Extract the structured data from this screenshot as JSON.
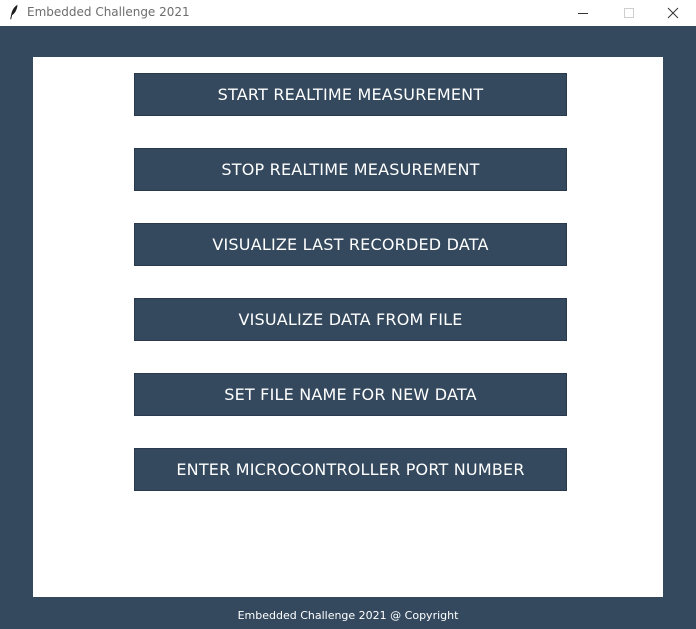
{
  "window": {
    "title": "Embedded Challenge 2021",
    "icons": {
      "app": "feather-icon",
      "minimize": "minimize-icon",
      "maximize": "maximize-icon",
      "close": "close-icon"
    }
  },
  "buttons": {
    "start_realtime": "START REALTIME MEASUREMENT",
    "stop_realtime": "STOP REALTIME MEASUREMENT",
    "visualize_last": "VISUALIZE LAST RECORDED DATA",
    "visualize_file": "VISUALIZE DATA FROM FILE",
    "set_file_name": "SET FILE NAME FOR NEW DATA",
    "enter_port": "ENTER MICROCONTROLLER PORT NUMBER"
  },
  "footer": {
    "text": "Embedded Challenge 2021 @ Copyright"
  },
  "colors": {
    "background": "#34495e",
    "panel": "#ffffff",
    "button": "#34495e",
    "button_text": "#ffffff"
  }
}
